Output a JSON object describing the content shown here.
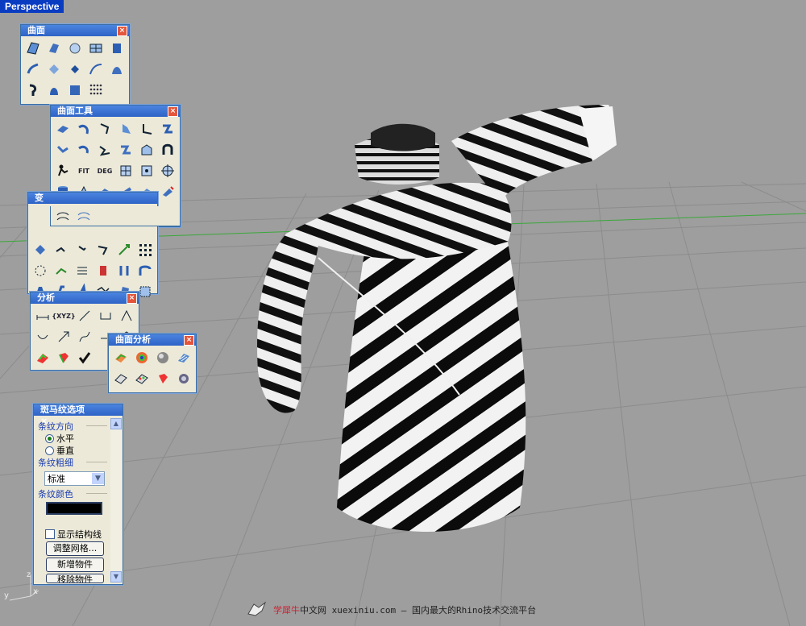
{
  "viewport": {
    "tab": "Perspective"
  },
  "toolbars": {
    "surface": {
      "title": "曲面"
    },
    "surface_tools": {
      "title": "曲面工具",
      "labels": [
        "FIT",
        "DEG"
      ]
    },
    "transform": {
      "title": "变"
    },
    "analysis": {
      "title": "分析",
      "labels": [
        "{XYZ}"
      ]
    },
    "surface_analysis": {
      "title": "曲面分析"
    }
  },
  "zebra_panel": {
    "title": "斑马纹选项",
    "direction_label": "条纹方向",
    "horizontal": "水平",
    "vertical": "垂直",
    "thickness_label": "条纹粗细",
    "thickness_value": "标准",
    "color_label": "条纹颜色",
    "stripe_color": "#000000",
    "show_structure": "显示结构线",
    "adjust_mesh": "调整网格...",
    "add_object": "新增物件",
    "remove_object": "移除物件"
  },
  "axes": {
    "x": "x",
    "y": "y",
    "z": "z"
  },
  "watermark": {
    "brand": "学犀牛",
    "rest": "中文网 xuexiniu.com  – 国内最大的Rhino技术交流平台"
  }
}
